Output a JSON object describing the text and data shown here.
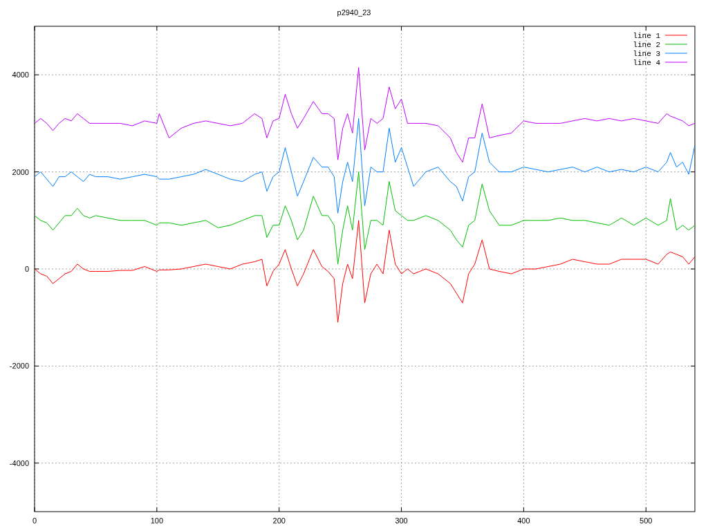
{
  "chart_data": {
    "type": "line",
    "title": "p2940_23",
    "x": [
      0,
      5,
      10,
      15,
      20,
      25,
      30,
      35,
      40,
      45,
      50,
      60,
      70,
      80,
      90,
      100,
      102,
      110,
      120,
      130,
      140,
      150,
      160,
      170,
      180,
      186,
      190,
      195,
      200,
      205,
      210,
      215,
      220,
      228,
      235,
      240,
      245,
      248,
      252,
      256,
      260,
      265,
      270,
      275,
      280,
      285,
      290,
      295,
      300,
      305,
      310,
      320,
      330,
      340,
      345,
      350,
      355,
      360,
      366,
      372,
      380,
      390,
      400,
      410,
      420,
      430,
      440,
      450,
      460,
      470,
      480,
      490,
      500,
      510,
      517,
      520,
      525,
      530,
      535,
      540
    ],
    "series": [
      {
        "name": "line 1",
        "color": "#ff0000",
        "values": [
          0,
          -100,
          -150,
          -300,
          -200,
          -100,
          -50,
          100,
          0,
          -50,
          -50,
          -50,
          -30,
          -30,
          50,
          -50,
          -20,
          -20,
          0,
          50,
          100,
          50,
          0,
          100,
          150,
          200,
          -350,
          -50,
          100,
          400,
          0,
          -350,
          -100,
          400,
          50,
          -50,
          -200,
          -1100,
          -300,
          100,
          -200,
          1000,
          -700,
          -100,
          100,
          -100,
          800,
          100,
          -100,
          0,
          -100,
          0,
          -100,
          -300,
          -500,
          -700,
          -100,
          100,
          600,
          0,
          -50,
          -100,
          0,
          0,
          50,
          100,
          200,
          150,
          100,
          100,
          200,
          200,
          200,
          100,
          300,
          350,
          300,
          250,
          100,
          250
        ]
      },
      {
        "name": "line 2",
        "color": "#00c000",
        "values": [
          1100,
          1000,
          950,
          800,
          950,
          1100,
          1100,
          1250,
          1100,
          1050,
          1100,
          1050,
          1000,
          1000,
          1000,
          900,
          950,
          950,
          900,
          950,
          1000,
          850,
          900,
          1000,
          1100,
          1100,
          650,
          900,
          900,
          1300,
          1000,
          600,
          800,
          1500,
          1100,
          1100,
          900,
          100,
          800,
          1300,
          800,
          2000,
          400,
          1000,
          1000,
          900,
          1800,
          1200,
          1100,
          1000,
          1000,
          1100,
          1000,
          800,
          600,
          450,
          900,
          1000,
          1750,
          1200,
          900,
          900,
          1000,
          1000,
          1000,
          1050,
          1000,
          1000,
          950,
          900,
          1050,
          900,
          1050,
          900,
          1000,
          1450,
          800,
          900,
          800,
          900
        ]
      },
      {
        "name": "line 3",
        "color": "#0080ff",
        "values": [
          1900,
          2000,
          1850,
          1700,
          1900,
          1900,
          2000,
          1900,
          1800,
          1950,
          1900,
          1900,
          1850,
          1900,
          1950,
          1900,
          1850,
          1850,
          1900,
          1950,
          2050,
          1950,
          1850,
          1800,
          1950,
          2000,
          1600,
          1900,
          2000,
          2500,
          2000,
          1500,
          1800,
          2300,
          2100,
          2100,
          1900,
          1150,
          1800,
          2200,
          1800,
          3100,
          1300,
          2100,
          2000,
          2000,
          2900,
          2200,
          2500,
          2100,
          1700,
          2000,
          2100,
          1800,
          1700,
          1400,
          1900,
          2000,
          2800,
          2200,
          2000,
          2000,
          2100,
          2050,
          2000,
          2050,
          2100,
          2000,
          2100,
          2000,
          2050,
          2000,
          2100,
          2000,
          2200,
          2400,
          2100,
          2200,
          1950,
          2550
        ]
      },
      {
        "name": "line 4",
        "color": "#c000ff",
        "values": [
          3000,
          3100,
          3000,
          2850,
          3000,
          3100,
          3050,
          3200,
          3100,
          3000,
          3000,
          3000,
          3000,
          2950,
          3050,
          3000,
          3200,
          2700,
          2900,
          3000,
          3050,
          3000,
          2950,
          3000,
          3200,
          3100,
          2700,
          3050,
          3100,
          3600,
          3200,
          2900,
          3100,
          3450,
          3200,
          3200,
          3100,
          2250,
          2900,
          3200,
          2800,
          4150,
          2450,
          3100,
          3000,
          3100,
          3750,
          3300,
          3500,
          3000,
          3000,
          3000,
          2950,
          2700,
          2400,
          2200,
          2700,
          2700,
          3400,
          2700,
          2750,
          2800,
          3050,
          3000,
          3000,
          3000,
          3050,
          3100,
          3050,
          3100,
          3050,
          3100,
          3050,
          3000,
          3200,
          3150,
          3100,
          3050,
          2950,
          3000
        ]
      }
    ],
    "xlim": [
      0,
      540
    ],
    "ylim": [
      -5000,
      5000
    ],
    "xticks": [
      0,
      100,
      200,
      300,
      400,
      500
    ],
    "yticks": [
      -4000,
      -2000,
      0,
      2000,
      4000
    ],
    "grid": true,
    "legend": true
  }
}
